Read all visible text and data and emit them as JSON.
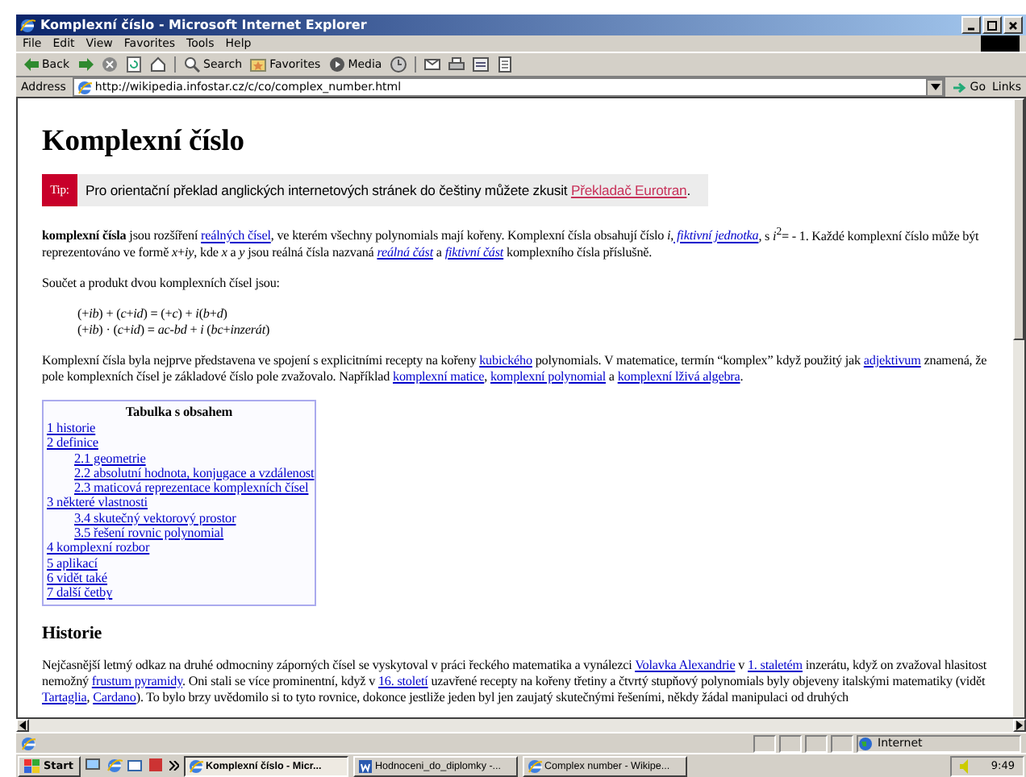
{
  "window": {
    "title": "Komplexní číslo - Microsoft Internet Explorer"
  },
  "menu": [
    "File",
    "Edit",
    "View",
    "Favorites",
    "Tools",
    "Help"
  ],
  "toolbar": [
    {
      "kind": "back",
      "label": "Back"
    },
    {
      "kind": "forward"
    },
    {
      "kind": "stop"
    },
    {
      "kind": "refresh"
    },
    {
      "kind": "home"
    },
    {
      "kind": "search",
      "label": "Search"
    },
    {
      "kind": "favorites",
      "label": "Favorites"
    },
    {
      "kind": "media",
      "label": "Media"
    },
    {
      "kind": "history"
    },
    {
      "kind": "mail"
    },
    {
      "kind": "print"
    },
    {
      "kind": "edit"
    },
    {
      "kind": "discuss"
    }
  ],
  "address": {
    "label": "Address",
    "url": "http://wikipedia.infostar.cz/c/co/complex_number.html",
    "go": "Go",
    "links": "Links"
  },
  "article": {
    "title": "Komplexní číslo",
    "tip": {
      "label": "Tip:",
      "text": "Pro orientační překlad anglických internetových stránek do češtiny můžete zkusit ",
      "link": "Překladač Eurotran",
      "end": "."
    },
    "blocks": [
      {
        "kind": "p",
        "segments": [
          {
            "text": "**komplexní čísla** jsou rozšíření "
          },
          {
            "link": "reálných čísel"
          },
          {
            "text": ", ve kterém všechny polynomials mají kořeny. Komplexní čísla obsahují číslo *i*,"
          },
          {
            "link": " fiktivní jednotka",
            "italic": true
          },
          {
            "text": ", s *i*$^{2}$= - 1. Každé komplexní číslo může být reprezentováno ve formě *x*+*iy*, kde *x* a *y* jsou reálná čísla nazvaná "
          },
          {
            "link": "reálná část",
            "italic": true
          },
          {
            "text": " a "
          },
          {
            "link": "fiktivní část",
            "italic": true
          },
          {
            "text": " komplexního čísla příslušně."
          }
        ]
      },
      {
        "kind": "p",
        "segments": [
          {
            "text": "Součet a produkt dvou komplexních čísel jsou:"
          }
        ]
      },
      {
        "kind": "formula",
        "lines": [
          "(+*ib*) + (*c*+*id*) = (+*c*) + *i*(*b*+*d*)",
          "(+*ib*) · (*c*+*id*) = *ac*-*bd* + *i* (*bc*+*inzerát*)"
        ]
      },
      {
        "kind": "p",
        "segments": [
          {
            "text": "Komplexní čísla byla nejprve představena ve spojení s explicitními recepty na kořeny "
          },
          {
            "link": "kubického"
          },
          {
            "text": " polynomials. V matematice, termín “komplex” když použitý jak "
          },
          {
            "link": "adjektivum"
          },
          {
            "text": " znamená, že pole komplexních čísel je základové číslo pole zvažovalo. Například "
          },
          {
            "link": "komplexní matice"
          },
          {
            "text": ", "
          },
          {
            "link": "komplexní polynomial"
          },
          {
            "text": " a "
          },
          {
            "link": "komplexní lživá algebra"
          },
          {
            "text": "."
          }
        ]
      },
      {
        "kind": "toc",
        "title": "Tabulka s obsahem",
        "items": [
          {
            "label": "1 historie"
          },
          {
            "label": "2 definice",
            "children": [
              {
                "label": "2.1 geometrie"
              },
              {
                "label": "2.2 absolutní hodnota, konjugace a vzdálenost"
              },
              {
                "label": "2.3 maticová reprezentace komplexních čísel"
              }
            ]
          },
          {
            "label": "3 některé vlastnosti",
            "children": [
              {
                "label": "3.4 skutečný vektorový prostor"
              },
              {
                "label": "3.5 řešení rovnic polynomial"
              }
            ]
          },
          {
            "label": "4 komplexní rozbor"
          },
          {
            "label": "5 aplikací"
          },
          {
            "label": "6 vidět také"
          },
          {
            "label": "7 další četby"
          }
        ]
      },
      {
        "kind": "h2",
        "text": "Historie"
      },
      {
        "kind": "p",
        "segments": [
          {
            "text": "Nejčasnější letmý odkaz na druhé odmocniny záporných čísel se vyskytoval v práci řeckého matematika a vynálezci "
          },
          {
            "link": "Volavka Alexandrie"
          },
          {
            "text": " v "
          },
          {
            "link": "1. staletém"
          },
          {
            "text": " inzerátu, když on zvažoval hlasitost nemožný "
          },
          {
            "link": "frustum"
          },
          {
            "link": " pyramidy"
          },
          {
            "text": ". Oni stali se více prominentní, když v "
          },
          {
            "link": "16. století"
          },
          {
            "text": " uzavřené recepty na kořeny třetiny a čtvrtý stupňový polynomials byly objeveny italskými matematiky (vidět "
          },
          {
            "link": "Tartaglia"
          },
          {
            "text": ", "
          },
          {
            "link": "Cardano"
          },
          {
            "text": "). To bylo brzy uvědomilo si to tyto rovnice, dokonce jestliže jeden byl jen zaujatý skutečnými řešeními, někdy žádal manipulaci od druhých"
          }
        ]
      }
    ]
  },
  "status": {
    "zone": "Internet"
  },
  "taskbar": {
    "start": "Start",
    "tasks": [
      {
        "label": "Komplexní číslo - Micr...",
        "selected": true,
        "kind": "ie"
      },
      {
        "label": "Hodnoceni_do_diplomky -...",
        "selected": false,
        "kind": "word"
      },
      {
        "label": "Complex number - Wikipe...",
        "selected": false,
        "kind": "ie"
      }
    ],
    "clock": "9:49"
  }
}
